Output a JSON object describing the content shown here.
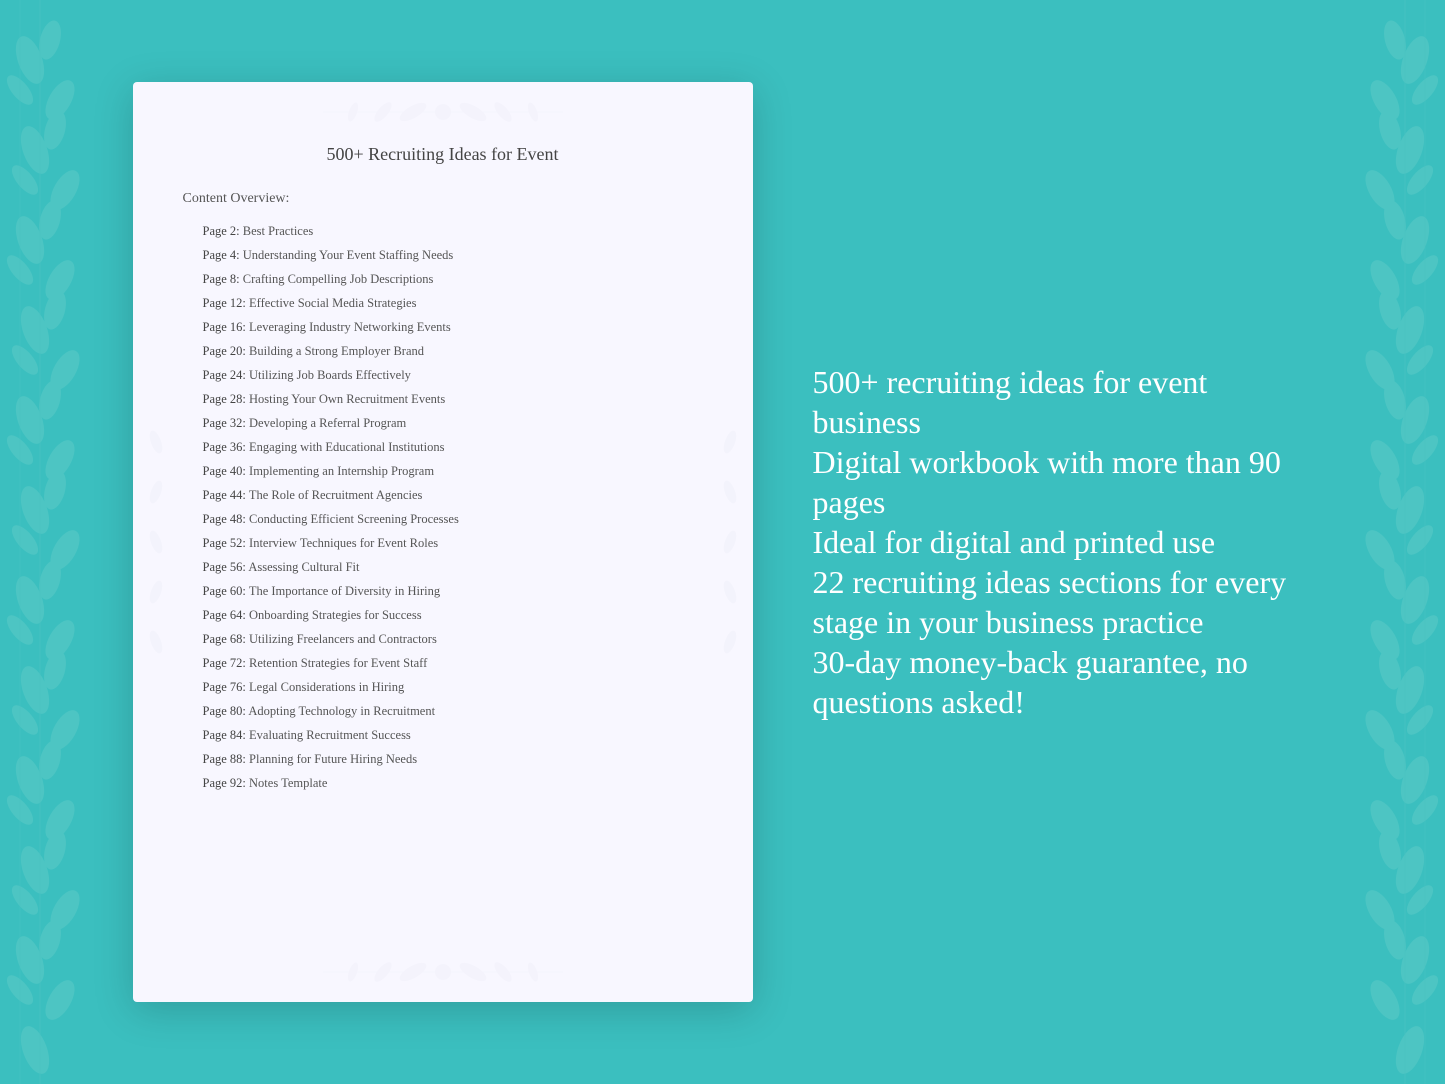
{
  "background_color": "#3bbfbf",
  "document": {
    "title": "500+ Recruiting Ideas for Event",
    "section_title": "Content Overview:",
    "toc_items": [
      {
        "page": "Page  2:",
        "topic": "Best Practices"
      },
      {
        "page": "Page  4:",
        "topic": "Understanding Your Event Staffing Needs"
      },
      {
        "page": "Page  8:",
        "topic": "Crafting Compelling Job Descriptions"
      },
      {
        "page": "Page 12:",
        "topic": "Effective Social Media Strategies"
      },
      {
        "page": "Page 16:",
        "topic": "Leveraging Industry Networking Events"
      },
      {
        "page": "Page 20:",
        "topic": "Building a Strong Employer Brand"
      },
      {
        "page": "Page 24:",
        "topic": "Utilizing Job Boards Effectively"
      },
      {
        "page": "Page 28:",
        "topic": "Hosting Your Own Recruitment Events"
      },
      {
        "page": "Page 32:",
        "topic": "Developing a Referral Program"
      },
      {
        "page": "Page 36:",
        "topic": "Engaging with Educational Institutions"
      },
      {
        "page": "Page 40:",
        "topic": "Implementing an Internship Program"
      },
      {
        "page": "Page 44:",
        "topic": "The Role of Recruitment Agencies"
      },
      {
        "page": "Page 48:",
        "topic": "Conducting Efficient Screening Processes"
      },
      {
        "page": "Page 52:",
        "topic": "Interview Techniques for Event Roles"
      },
      {
        "page": "Page 56:",
        "topic": "Assessing Cultural Fit"
      },
      {
        "page": "Page 60:",
        "topic": "The Importance of Diversity in Hiring"
      },
      {
        "page": "Page 64:",
        "topic": "Onboarding Strategies for Success"
      },
      {
        "page": "Page 68:",
        "topic": "Utilizing Freelancers and Contractors"
      },
      {
        "page": "Page 72:",
        "topic": "Retention Strategies for Event Staff"
      },
      {
        "page": "Page 76:",
        "topic": "Legal Considerations in Hiring"
      },
      {
        "page": "Page 80:",
        "topic": "Adopting Technology in Recruitment"
      },
      {
        "page": "Page 84:",
        "topic": "Evaluating Recruitment Success"
      },
      {
        "page": "Page 88:",
        "topic": "Planning for Future Hiring Needs"
      },
      {
        "page": "Page 92:",
        "topic": "Notes Template"
      }
    ]
  },
  "features": [
    {
      "text": "500+ recruiting ideas for event business"
    },
    {
      "text": "Digital workbook with more than 90 pages"
    },
    {
      "text": "Ideal for digital and printed use"
    },
    {
      "text": "22 recruiting ideas sections for every stage in your business practice"
    },
    {
      "text": "30-day money-back guarantee, no questions asked!"
    }
  ]
}
